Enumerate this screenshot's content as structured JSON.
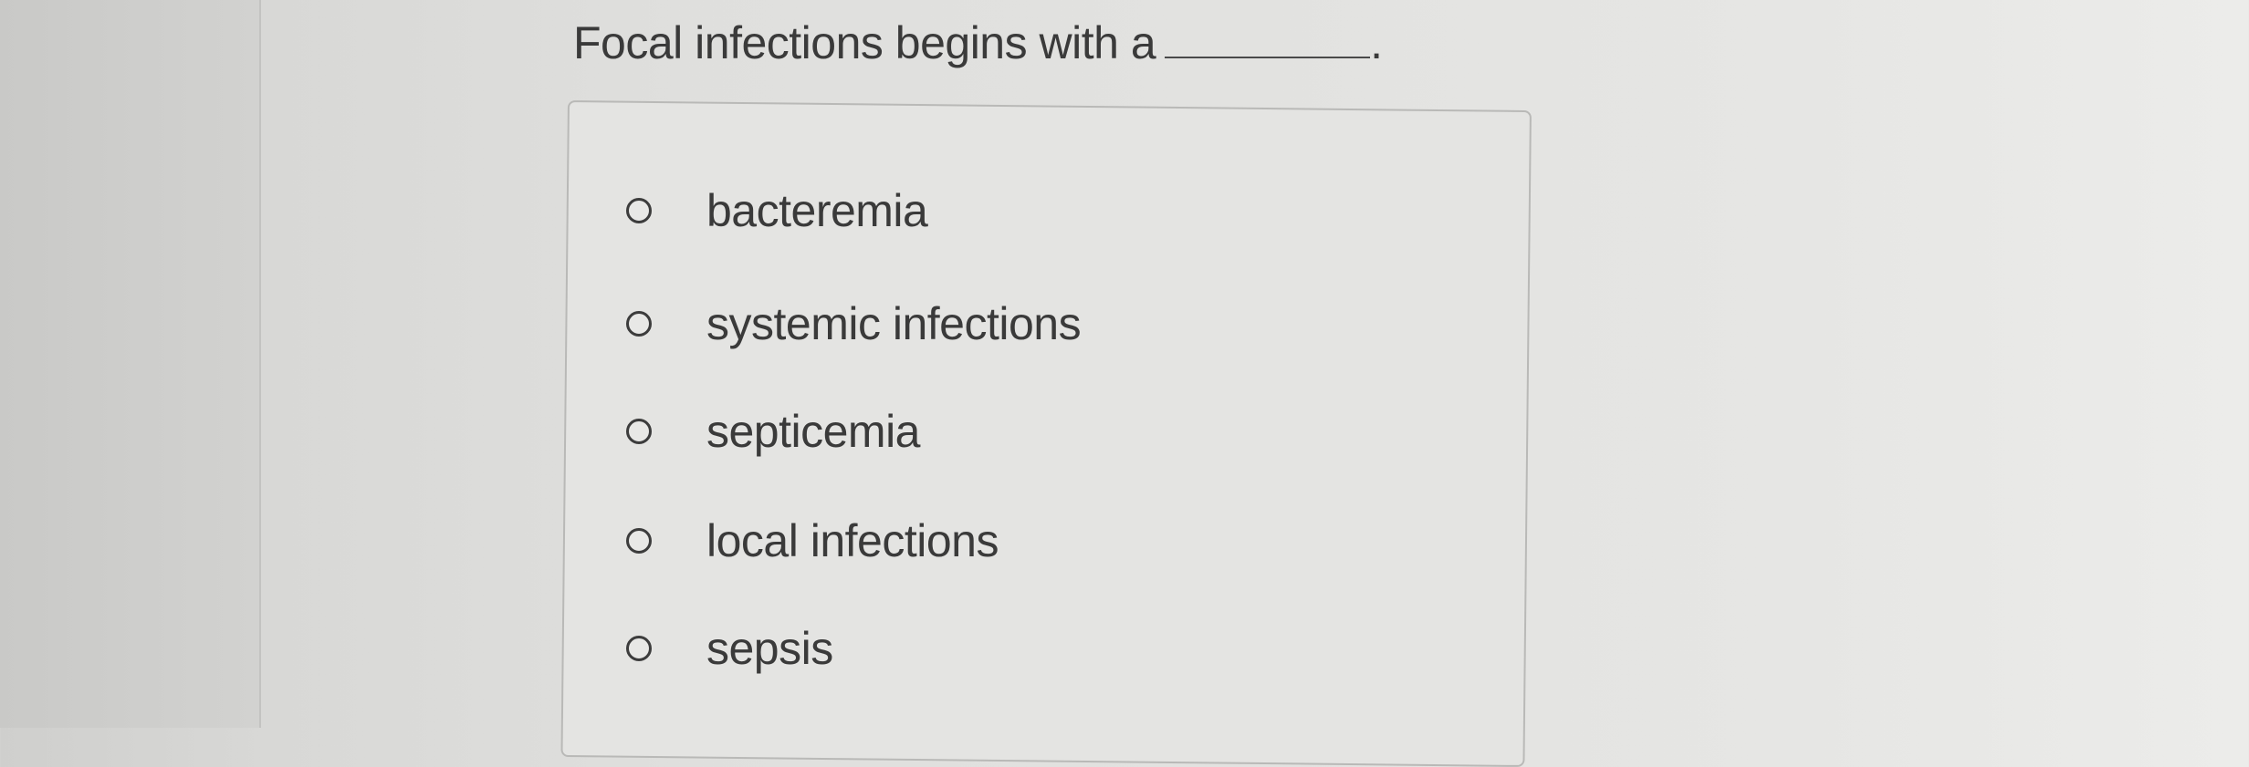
{
  "question": {
    "text": "Focal infections begins with a",
    "trailing": "."
  },
  "options": [
    {
      "label": "bacteremia",
      "selected": false
    },
    {
      "label": "systemic infections",
      "selected": false
    },
    {
      "label": "septicemia",
      "selected": false
    },
    {
      "label": "local infections",
      "selected": false
    },
    {
      "label": "sepsis",
      "selected": false
    }
  ]
}
